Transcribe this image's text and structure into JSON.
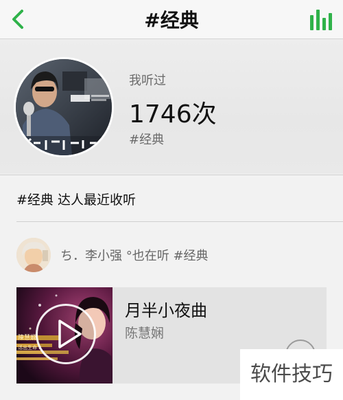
{
  "nav": {
    "title": "#经典",
    "back_icon": "chevron-left-icon",
    "stats_icon": "bar-chart-icon",
    "accent": "#2fb24a"
  },
  "profile": {
    "listen_label": "我听过",
    "listen_count": "1746次",
    "tag": "#经典"
  },
  "section": {
    "title": "#经典 达人最近收听"
  },
  "friend": {
    "activity": "ち．李小强 °也在听 #经典"
  },
  "song": {
    "title": "月半小夜曲",
    "artist": "陈慧娴",
    "cover_brand": "陳慧嫺",
    "cover_concert": "活出生命 II"
  },
  "watermark": {
    "text": "软件技巧"
  }
}
